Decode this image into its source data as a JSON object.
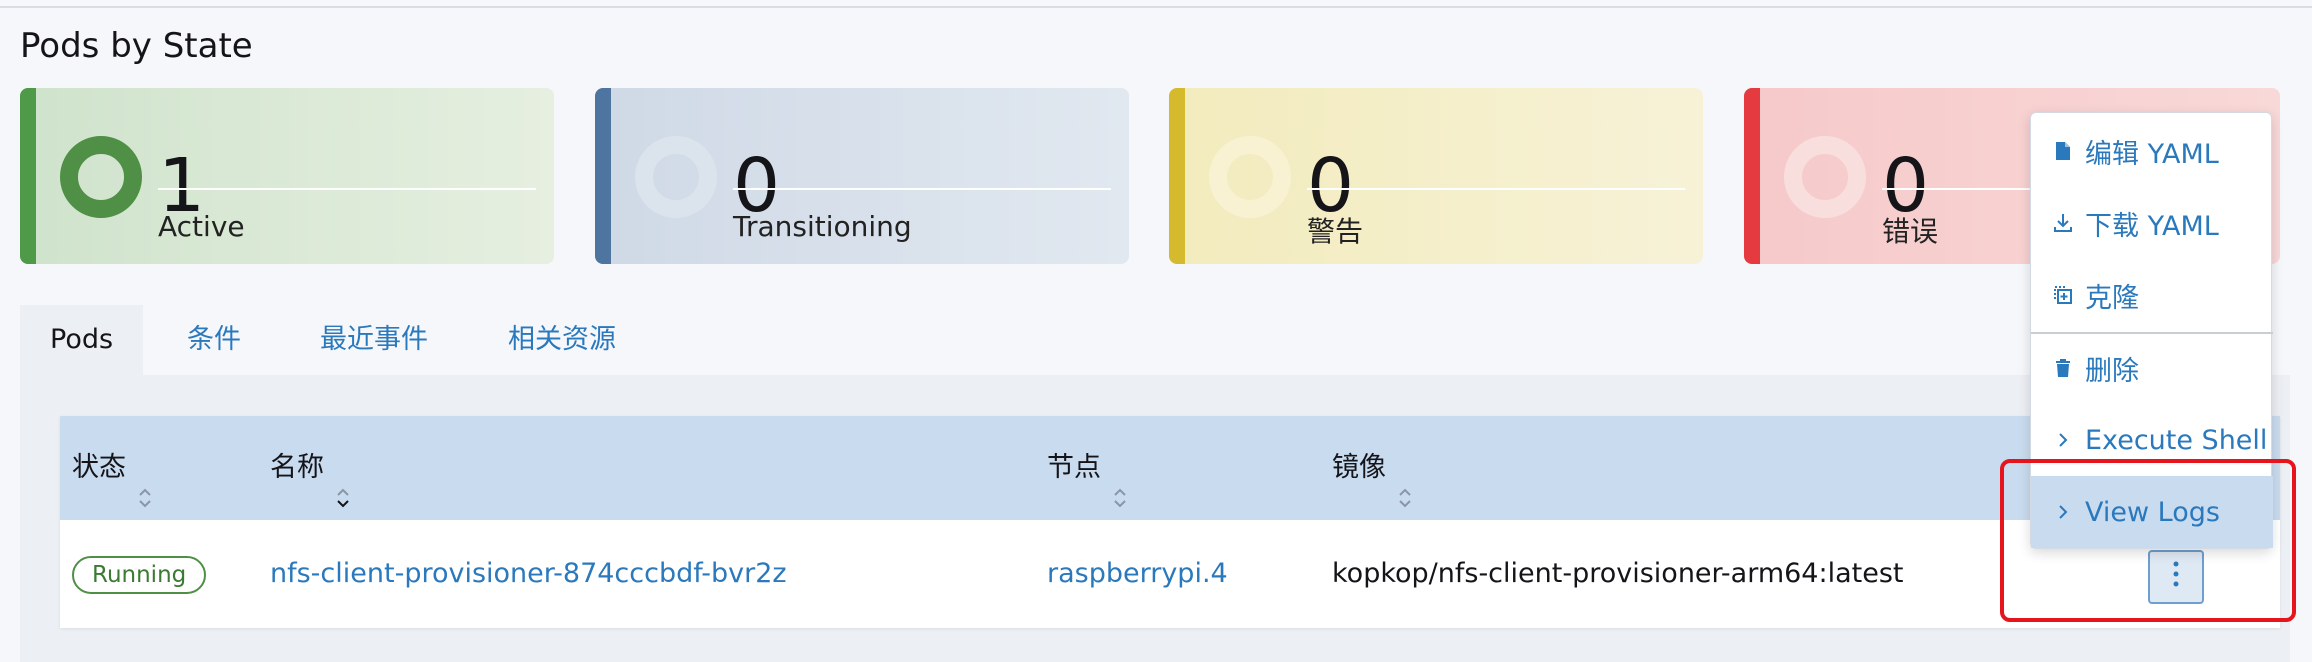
{
  "section_title": "Pods by State",
  "state_cards": {
    "active": {
      "count": "1",
      "label": "Active",
      "color": "#4e9a49"
    },
    "transitioning": {
      "count": "0",
      "label": "Transitioning",
      "color": "#4e74a0"
    },
    "warning": {
      "count": "0",
      "label": "警告",
      "color": "#d6ba2e"
    },
    "error": {
      "count": "0",
      "label": "错误",
      "color": "#e53a3f"
    }
  },
  "tabs": [
    {
      "label": "Pods",
      "active": true
    },
    {
      "label": "条件",
      "active": false
    },
    {
      "label": "最近事件",
      "active": false
    },
    {
      "label": "相关资源",
      "active": false
    }
  ],
  "table": {
    "headers": [
      "状态",
      "名称",
      "节点",
      "镜像"
    ],
    "rows": [
      {
        "status": "Running",
        "name": "nfs-client-provisioner-874cccbdf-bvr2z",
        "node": "raspberrypi.4",
        "image": "kopkop/nfs-client-provisioner-arm64:latest"
      }
    ]
  },
  "action_menu": {
    "items": [
      {
        "label": "编辑 YAML",
        "icon": "file-icon"
      },
      {
        "label": "下载 YAML",
        "icon": "download-icon"
      },
      {
        "label": "克隆",
        "icon": "clone-icon"
      },
      {
        "label": "删除",
        "icon": "trash-icon"
      },
      {
        "label": "Execute Shell",
        "icon": "chevron-right-icon"
      },
      {
        "label": "View Logs",
        "icon": "chevron-right-icon",
        "hovered": true
      }
    ]
  },
  "kebab_icon": "kebab-vertical-icon",
  "accent_color": "#2b79bd",
  "highlight_color": "#e5141d"
}
